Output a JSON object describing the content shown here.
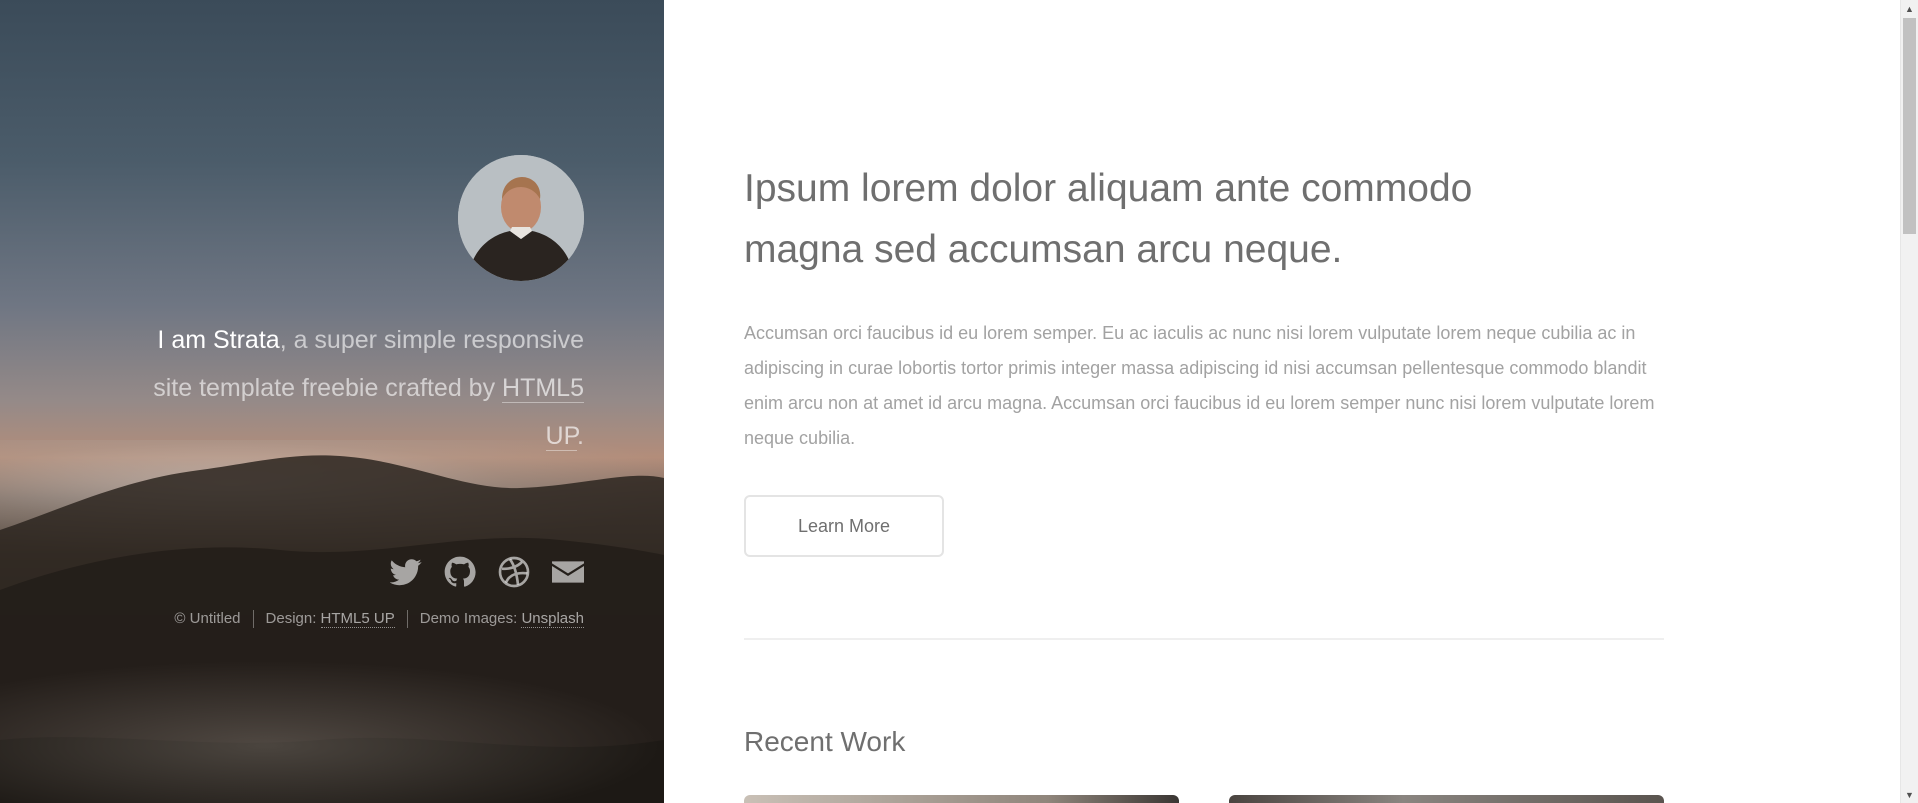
{
  "header": {
    "intro_strong": "I am Strata",
    "intro_rest_1": ", a super simple responsive site template freebie crafted by ",
    "intro_link": "HTML5 UP",
    "intro_end": ".",
    "avatar": "person-avatar"
  },
  "footer": {
    "icons": [
      "twitter-icon",
      "github-icon",
      "dribbble-icon",
      "envelope-icon"
    ],
    "copyright": "© Untitled",
    "design_label": "Design: ",
    "design_link": "HTML5 UP",
    "images_label": "Demo Images: ",
    "images_link": "Unsplash"
  },
  "main": {
    "lead": "Ipsum lorem dolor aliquam ante commodo magna sed accumsan arcu neque.",
    "body": "Accumsan orci faucibus id eu lorem semper. Eu ac iaculis ac nunc nisi lorem vulputate lorem neque cubilia ac in adipiscing in curae lobortis tortor primis integer massa adipiscing id nisi accumsan pellentesque commodo blandit enim arcu non at amet id arcu magna. Accumsan orci faucibus id eu lorem semper nunc nisi lorem vulputate lorem neque cubilia.",
    "button_label": "Learn More",
    "recent_heading": "Recent Work"
  },
  "colors": {
    "accent_text": "#6f6f6f",
    "muted_text": "#a2a2a2",
    "divider": "#efefef"
  }
}
